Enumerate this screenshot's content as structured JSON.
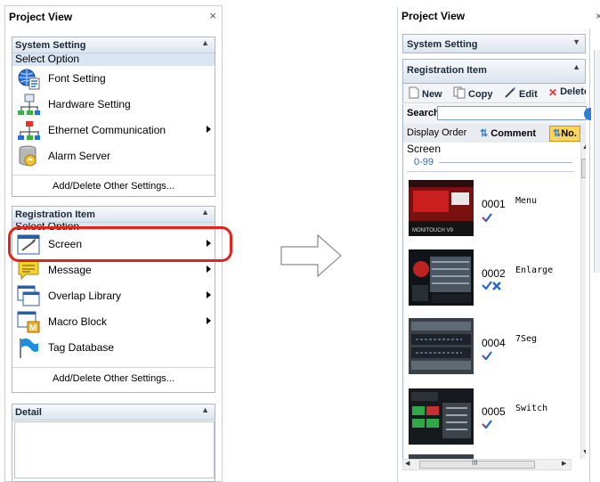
{
  "left_panel": {
    "title": "Project View",
    "close": "×",
    "system_setting": {
      "header": "System Setting",
      "select_option": "Select Option",
      "items": [
        {
          "label": "Font Setting",
          "icon": "globe-font-icon",
          "submenu": false
        },
        {
          "label": "Hardware Setting",
          "icon": "hardware-icon",
          "submenu": false
        },
        {
          "label": "Ethernet Communication",
          "icon": "network-icon",
          "submenu": true
        },
        {
          "label": "Alarm Server",
          "icon": "alarm-server-icon",
          "submenu": false
        }
      ],
      "add_delete": "Add/Delete Other Settings..."
    },
    "registration_item": {
      "header": "Registration Item",
      "select_option": "Select Option",
      "items": [
        {
          "label": "Screen",
          "icon": "screen-icon",
          "submenu": true,
          "highlighted": true
        },
        {
          "label": "Message",
          "icon": "message-icon",
          "submenu": true
        },
        {
          "label": "Overlap Library",
          "icon": "overlap-library-icon",
          "submenu": true
        },
        {
          "label": "Macro Block",
          "icon": "macro-block-icon",
          "submenu": true
        },
        {
          "label": "Tag Database",
          "icon": "tag-flag-icon",
          "submenu": false
        }
      ],
      "add_delete": "Add/Delete Other Settings..."
    },
    "detail": {
      "header": "Detail"
    }
  },
  "right_panel": {
    "title": "Project View",
    "close": "×",
    "system_setting_header": "System Setting",
    "registration_header": "Registration Item",
    "toolbar": {
      "new": "New",
      "copy": "Copy",
      "edit": "Edit",
      "delete": "Delete"
    },
    "search_label": "Search",
    "order": {
      "display_order": "Display Order",
      "comment": "Comment",
      "no": "No."
    },
    "screen_header": "Screen",
    "range": "0-99",
    "screens": [
      {
        "no": "0001",
        "name": "Menu",
        "status": "check"
      },
      {
        "no": "0002",
        "name": "Enlarge",
        "status": "check-cross"
      },
      {
        "no": "0004",
        "name": "7Seg",
        "status": "check"
      },
      {
        "no": "0005",
        "name": "Switch",
        "status": "check"
      }
    ],
    "hscroll_mark": "III"
  },
  "colors": {
    "highlight": "#e0241b",
    "accent_blue": "#2f6db5",
    "selected_order": "#ffd45a"
  }
}
